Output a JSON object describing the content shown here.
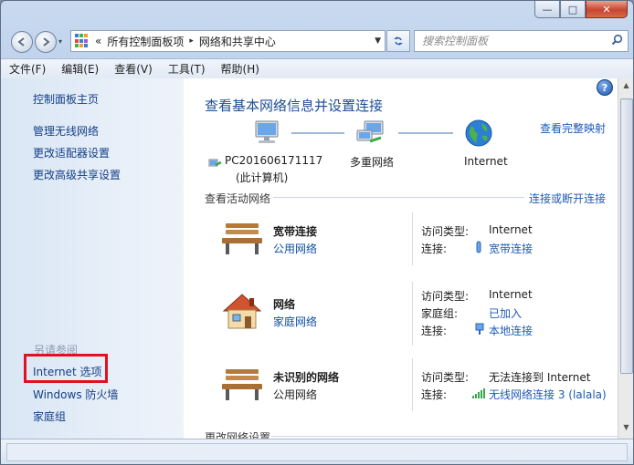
{
  "window": {
    "caption_min": "—",
    "caption_max": "□",
    "caption_close": "✕"
  },
  "address": {
    "chevrons": "«",
    "crumb1": "所有控制面板项",
    "sep": "▸",
    "crumb2": "网络和共享中心",
    "dropdown": "▼"
  },
  "search": {
    "placeholder": "搜索控制面板"
  },
  "menu": [
    "文件(F)",
    "编辑(E)",
    "查看(V)",
    "工具(T)",
    "帮助(H)"
  ],
  "sidebar": {
    "home": "控制面板主页",
    "tasks": [
      "管理无线网络",
      "更改适配器设置",
      "更改高级共享设置"
    ],
    "see_also_title": "另请参阅",
    "see_also": [
      "Internet 选项",
      "Windows 防火墙",
      "家庭组"
    ]
  },
  "main": {
    "title": "查看基本网络信息并设置连接",
    "full_map": "查看完整映射",
    "map": {
      "computer_name": "PC201606171117",
      "computer_sub": "(此计算机)",
      "middle": "多重网络",
      "internet": "Internet"
    },
    "active_title": "查看活动网络",
    "connect_link": "连接或断开连接",
    "networks": [
      {
        "name": "宽带连接",
        "type": "公用网络",
        "type_is_link": true,
        "rows": [
          {
            "k": "访问类型:",
            "v": "Internet",
            "link": false
          },
          {
            "k": "连接:",
            "v": "宽带连接",
            "link": true
          }
        ]
      },
      {
        "name": "网络",
        "type": "家庭网络",
        "type_is_link": true,
        "rows": [
          {
            "k": "访问类型:",
            "v": "Internet",
            "link": false
          },
          {
            "k": "家庭组:",
            "v": "已加入",
            "link": true
          },
          {
            "k": "连接:",
            "v": "本地连接",
            "link": true
          }
        ]
      },
      {
        "name": "未识别的网络",
        "type": "公用网络",
        "type_is_link": false,
        "rows": [
          {
            "k": "访问类型:",
            "v": "无法连接到 Internet",
            "link": false
          },
          {
            "k": "连接:",
            "v": "无线网络连接 3 (lalala)",
            "link": true
          }
        ]
      }
    ],
    "change_title": "更改网络设置"
  },
  "help": "?",
  "icons": {
    "back": "arrow-left-icon",
    "forward": "arrow-right-icon",
    "refresh": "refresh-icon",
    "search": "magnifier-icon"
  }
}
